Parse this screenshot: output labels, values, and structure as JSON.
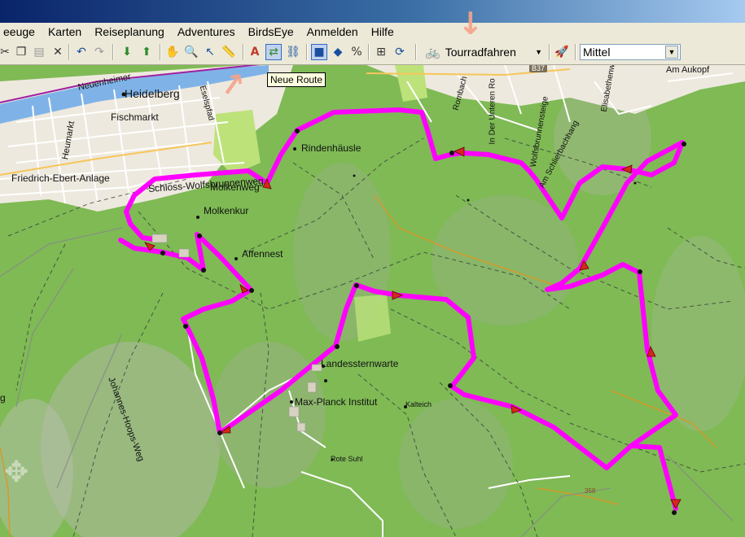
{
  "menu": [
    "eeuge",
    "Karten",
    "Reiseplanung",
    "Adventures",
    "BirdsEye",
    "Anmelden",
    "Hilfe"
  ],
  "toolbar": {
    "profile_value": "Tourradfahren",
    "speed_value": "Mittel",
    "tooltip": "Neue Route",
    "icons": [
      "cut-icon",
      "copy-icon",
      "paste-icon",
      "delete-icon",
      "undo-icon",
      "redo-icon",
      "receive-from-device-icon",
      "send-to-device-icon",
      "hand-pan-icon",
      "zoom-icon",
      "select-arrow-icon",
      "measure-icon",
      "text-tool-icon",
      "new-route-icon",
      "track-tool-icon",
      "map-view-icon",
      "3d-view-icon",
      "filter-icon",
      "zoom-fit-icon",
      "recalculate-icon",
      "bicycle-icon",
      "navigate-icon"
    ]
  },
  "map": {
    "route_color": "#ff00ff",
    "labels": {
      "heidelberg": "Heidelberg",
      "neuenheimer": "Neuenheimer",
      "fischmarkt": "Fischmarkt",
      "heumarkt": "Heumarkt",
      "friedrich": "Friedrich-Ebert-Anlage",
      "schloss": "Schloss-Wolfsbrunnenweg",
      "molkenweg": "Molkenweg",
      "molkenkur": "Molkenkur",
      "affennest": "Affennest",
      "rindenhaeusle": "Rindenhäusle",
      "landessternwarte": "Landessternwarte",
      "max_planck": "Max-Planck Institut",
      "kalteich": "Kalteich",
      "rote_suhl": "Rote Suhl",
      "johannes": "Johannes-Hoops-Weg",
      "b37": "B37",
      "am_aukopf": "Am Aukopf",
      "rombach": "Rombach",
      "unteren": "In Der Unteren Ro",
      "wolfsbrunnensteige": "Wolfsbrunnensteige",
      "schlierbach": "Am Schlierbachhang",
      "elisabeth": "Elisabethenweg",
      "eselspfad": "Eselspfad",
      "n358": "358",
      "g_left": "g"
    }
  }
}
